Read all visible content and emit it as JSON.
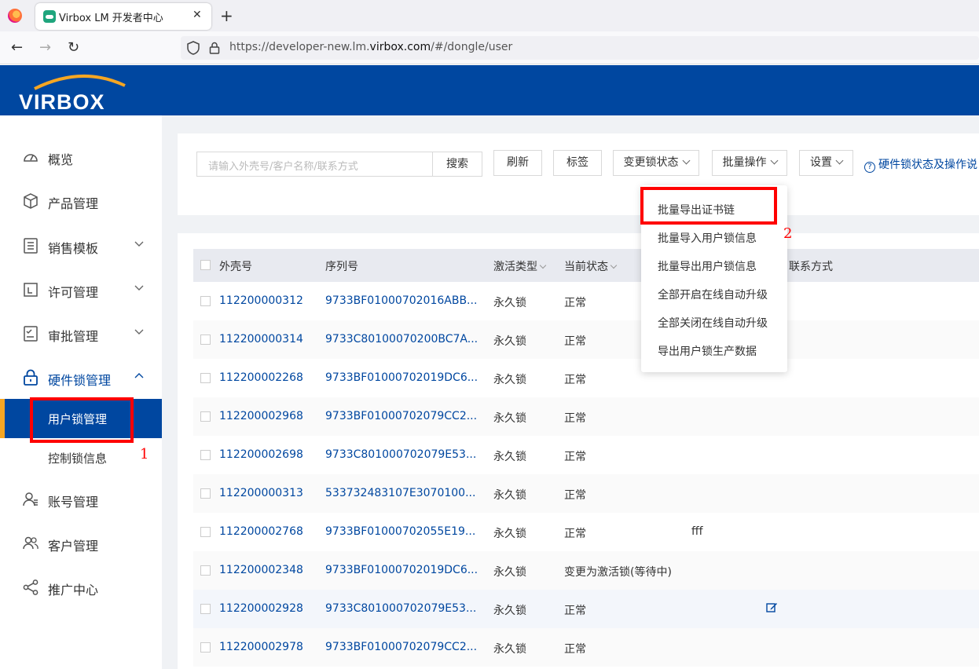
{
  "browser": {
    "tab_title": "Virbox LM 开发者中心",
    "close": "✕",
    "new_tab": "+",
    "url_prefix": "https://developer-new.lm.",
    "url_domain": "virbox.com",
    "url_suffix": "/#/dongle/user",
    "back": "←",
    "forward": "→",
    "reload": "↻"
  },
  "header": {
    "logo_text": "VIRBOX",
    "brand_color": "#0047a0"
  },
  "sidebar": {
    "items": [
      {
        "label": "概览",
        "icon": "dashboard-icon"
      },
      {
        "label": "产品管理",
        "icon": "cube-icon"
      },
      {
        "label": "销售模板",
        "icon": "list-icon",
        "arrow": "down"
      },
      {
        "label": "许可管理",
        "icon": "license-icon",
        "arrow": "down"
      },
      {
        "label": "审批管理",
        "icon": "approval-icon",
        "arrow": "down"
      },
      {
        "label": "硬件锁管理",
        "icon": "lock-icon",
        "arrow": "up"
      },
      {
        "label": "账号管理",
        "icon": "user-icon"
      },
      {
        "label": "客户管理",
        "icon": "users-icon"
      },
      {
        "label": "推广中心",
        "icon": "share-icon"
      }
    ],
    "sub_items": [
      {
        "label": "用户锁管理",
        "active": true
      },
      {
        "label": "控制锁信息",
        "active": false
      }
    ]
  },
  "annotations": {
    "num1": "1",
    "num2": "2"
  },
  "toolbar": {
    "search_placeholder": "请输入外壳号/客户名称/联系方式",
    "search_button": "搜索",
    "refresh": "刷新",
    "tag": "标签",
    "change_status": "变更锁状态",
    "batch_ops": "批量操作",
    "settings": "设置",
    "help": "硬件锁状态及操作说"
  },
  "dropdown": {
    "items": [
      "批量导出证书链",
      "批量导入用户锁信息",
      "批量导出用户锁信息",
      "全部开启在线自动升级",
      "全部关闭在线自动升级",
      "导出用户锁生产数据"
    ]
  },
  "table": {
    "columns": [
      "外壳号",
      "序列号",
      "激活类型",
      "当前状态",
      "联系方式"
    ],
    "rows": [
      {
        "shell": "112200000312",
        "serial": "9733BF01000702016ABB...",
        "type": "永久锁",
        "status": "正常",
        "extra": ""
      },
      {
        "shell": "112200000314",
        "serial": "9733C80100070200BC7A...",
        "type": "永久锁",
        "status": "正常",
        "extra": ""
      },
      {
        "shell": "112200002268",
        "serial": "9733BF01000702019DC6...",
        "type": "永久锁",
        "status": "正常",
        "extra": ""
      },
      {
        "shell": "112200002968",
        "serial": "9733BF01000702079CC2...",
        "type": "永久锁",
        "status": "正常",
        "extra": ""
      },
      {
        "shell": "112200002698",
        "serial": "9733C801000702079E53...",
        "type": "永久锁",
        "status": "正常",
        "extra": ""
      },
      {
        "shell": "112200000313",
        "serial": "533732483107E3070100...",
        "type": "永久锁",
        "status": "正常",
        "extra": ""
      },
      {
        "shell": "112200002768",
        "serial": "9733BF01000702055E19...",
        "type": "永久锁",
        "status": "正常",
        "extra": "fff"
      },
      {
        "shell": "112200002348",
        "serial": "9733BF01000702019DC6...",
        "type": "永久锁",
        "status": "变更为激活锁(等待中)",
        "extra": ""
      },
      {
        "shell": "112200002928",
        "serial": "9733C801000702079E53...",
        "type": "永久锁",
        "status": "正常",
        "extra": ""
      },
      {
        "shell": "112200002978",
        "serial": "9733BF01000702079CC2...",
        "type": "永久锁",
        "status": "正常",
        "extra": ""
      }
    ]
  }
}
